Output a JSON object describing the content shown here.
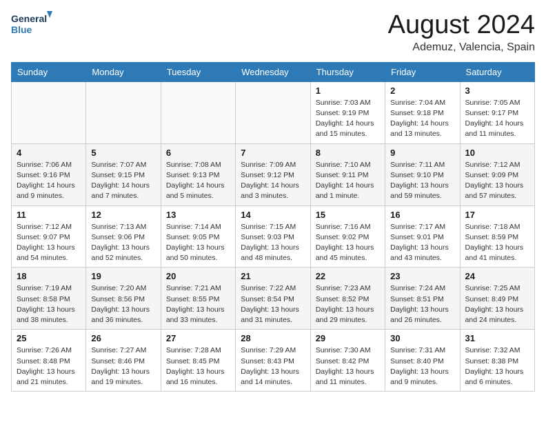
{
  "logo": {
    "text_general": "General",
    "text_blue": "Blue"
  },
  "header": {
    "month": "August 2024",
    "location": "Ademuz, Valencia, Spain"
  },
  "weekdays": [
    "Sunday",
    "Monday",
    "Tuesday",
    "Wednesday",
    "Thursday",
    "Friday",
    "Saturday"
  ],
  "weeks": [
    [
      {
        "day": "",
        "info": ""
      },
      {
        "day": "",
        "info": ""
      },
      {
        "day": "",
        "info": ""
      },
      {
        "day": "",
        "info": ""
      },
      {
        "day": "1",
        "info": "Sunrise: 7:03 AM\nSunset: 9:19 PM\nDaylight: 14 hours\nand 15 minutes."
      },
      {
        "day": "2",
        "info": "Sunrise: 7:04 AM\nSunset: 9:18 PM\nDaylight: 14 hours\nand 13 minutes."
      },
      {
        "day": "3",
        "info": "Sunrise: 7:05 AM\nSunset: 9:17 PM\nDaylight: 14 hours\nand 11 minutes."
      }
    ],
    [
      {
        "day": "4",
        "info": "Sunrise: 7:06 AM\nSunset: 9:16 PM\nDaylight: 14 hours\nand 9 minutes."
      },
      {
        "day": "5",
        "info": "Sunrise: 7:07 AM\nSunset: 9:15 PM\nDaylight: 14 hours\nand 7 minutes."
      },
      {
        "day": "6",
        "info": "Sunrise: 7:08 AM\nSunset: 9:13 PM\nDaylight: 14 hours\nand 5 minutes."
      },
      {
        "day": "7",
        "info": "Sunrise: 7:09 AM\nSunset: 9:12 PM\nDaylight: 14 hours\nand 3 minutes."
      },
      {
        "day": "8",
        "info": "Sunrise: 7:10 AM\nSunset: 9:11 PM\nDaylight: 14 hours\nand 1 minute."
      },
      {
        "day": "9",
        "info": "Sunrise: 7:11 AM\nSunset: 9:10 PM\nDaylight: 13 hours\nand 59 minutes."
      },
      {
        "day": "10",
        "info": "Sunrise: 7:12 AM\nSunset: 9:09 PM\nDaylight: 13 hours\nand 57 minutes."
      }
    ],
    [
      {
        "day": "11",
        "info": "Sunrise: 7:12 AM\nSunset: 9:07 PM\nDaylight: 13 hours\nand 54 minutes."
      },
      {
        "day": "12",
        "info": "Sunrise: 7:13 AM\nSunset: 9:06 PM\nDaylight: 13 hours\nand 52 minutes."
      },
      {
        "day": "13",
        "info": "Sunrise: 7:14 AM\nSunset: 9:05 PM\nDaylight: 13 hours\nand 50 minutes."
      },
      {
        "day": "14",
        "info": "Sunrise: 7:15 AM\nSunset: 9:03 PM\nDaylight: 13 hours\nand 48 minutes."
      },
      {
        "day": "15",
        "info": "Sunrise: 7:16 AM\nSunset: 9:02 PM\nDaylight: 13 hours\nand 45 minutes."
      },
      {
        "day": "16",
        "info": "Sunrise: 7:17 AM\nSunset: 9:01 PM\nDaylight: 13 hours\nand 43 minutes."
      },
      {
        "day": "17",
        "info": "Sunrise: 7:18 AM\nSunset: 8:59 PM\nDaylight: 13 hours\nand 41 minutes."
      }
    ],
    [
      {
        "day": "18",
        "info": "Sunrise: 7:19 AM\nSunset: 8:58 PM\nDaylight: 13 hours\nand 38 minutes."
      },
      {
        "day": "19",
        "info": "Sunrise: 7:20 AM\nSunset: 8:56 PM\nDaylight: 13 hours\nand 36 minutes."
      },
      {
        "day": "20",
        "info": "Sunrise: 7:21 AM\nSunset: 8:55 PM\nDaylight: 13 hours\nand 33 minutes."
      },
      {
        "day": "21",
        "info": "Sunrise: 7:22 AM\nSunset: 8:54 PM\nDaylight: 13 hours\nand 31 minutes."
      },
      {
        "day": "22",
        "info": "Sunrise: 7:23 AM\nSunset: 8:52 PM\nDaylight: 13 hours\nand 29 minutes."
      },
      {
        "day": "23",
        "info": "Sunrise: 7:24 AM\nSunset: 8:51 PM\nDaylight: 13 hours\nand 26 minutes."
      },
      {
        "day": "24",
        "info": "Sunrise: 7:25 AM\nSunset: 8:49 PM\nDaylight: 13 hours\nand 24 minutes."
      }
    ],
    [
      {
        "day": "25",
        "info": "Sunrise: 7:26 AM\nSunset: 8:48 PM\nDaylight: 13 hours\nand 21 minutes."
      },
      {
        "day": "26",
        "info": "Sunrise: 7:27 AM\nSunset: 8:46 PM\nDaylight: 13 hours\nand 19 minutes."
      },
      {
        "day": "27",
        "info": "Sunrise: 7:28 AM\nSunset: 8:45 PM\nDaylight: 13 hours\nand 16 minutes."
      },
      {
        "day": "28",
        "info": "Sunrise: 7:29 AM\nSunset: 8:43 PM\nDaylight: 13 hours\nand 14 minutes."
      },
      {
        "day": "29",
        "info": "Sunrise: 7:30 AM\nSunset: 8:42 PM\nDaylight: 13 hours\nand 11 minutes."
      },
      {
        "day": "30",
        "info": "Sunrise: 7:31 AM\nSunset: 8:40 PM\nDaylight: 13 hours\nand 9 minutes."
      },
      {
        "day": "31",
        "info": "Sunrise: 7:32 AM\nSunset: 8:38 PM\nDaylight: 13 hours\nand 6 minutes."
      }
    ]
  ]
}
